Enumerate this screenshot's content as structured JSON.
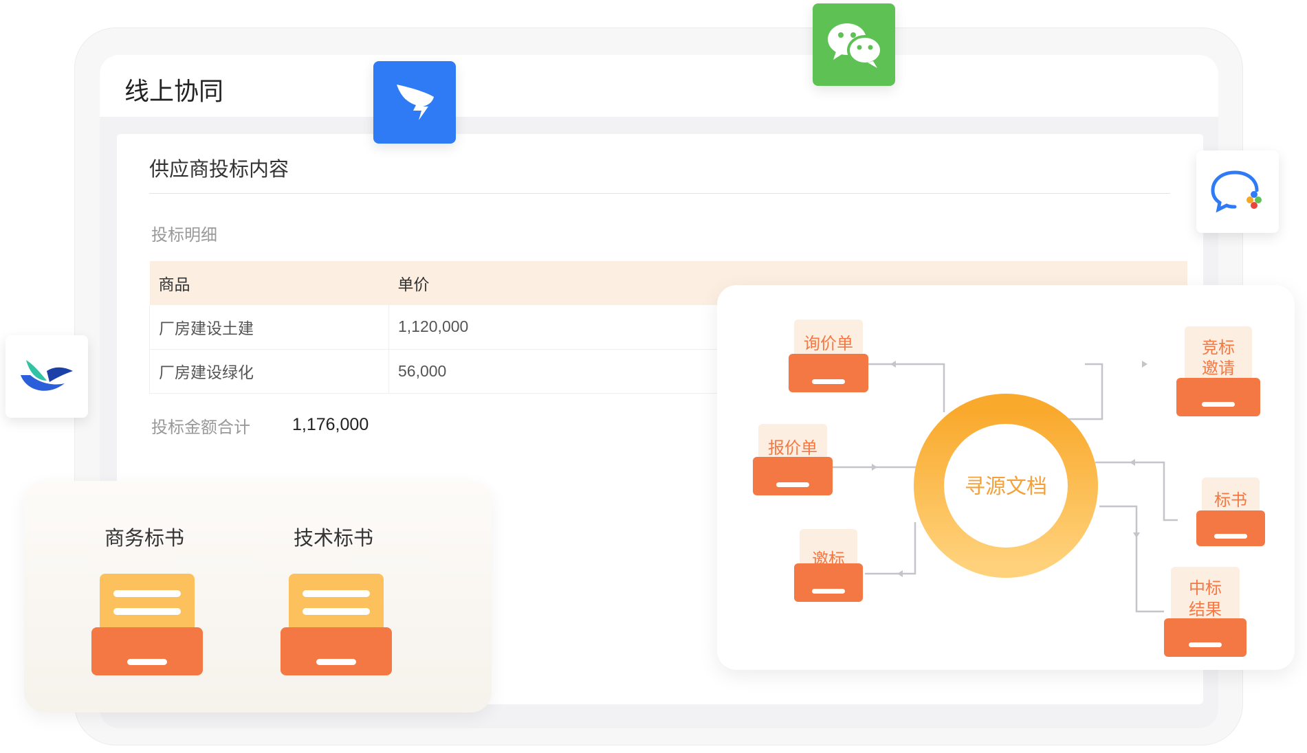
{
  "window": {
    "title": "线上协同"
  },
  "bid_section": {
    "title": "供应商投标内容",
    "subtitle": "投标明细",
    "columns": [
      "商品",
      "单价"
    ],
    "rows": [
      {
        "item": "厂房建设土建",
        "price": "1,120,000"
      },
      {
        "item": "厂房建设绿化",
        "price": "56,000"
      }
    ],
    "total_label": "投标金额合计",
    "total_value": "1,176,000"
  },
  "tender_docs": {
    "business": "商务标书",
    "technical": "技术标书"
  },
  "sourcing": {
    "center": "寻源文档",
    "inquiry": "询价单",
    "quotation": "报价单",
    "invitation": "邀标",
    "bid_invite_line1": "竞标",
    "bid_invite_line2": "邀请",
    "bid_doc": "标书",
    "award_line1": "中标",
    "award_line2": "结果"
  },
  "apps": {
    "dingtalk": "dingtalk-icon",
    "wechat": "wechat-icon",
    "wecom": "wecom-icon",
    "feishu": "feishu-icon"
  },
  "colors": {
    "orange": "#f47843",
    "folder_yellow": "#fcc15d",
    "ring_start": "#f9a92c",
    "ring_end": "#ffd17a",
    "dingtalk_blue": "#2f7bf6",
    "wechat_green": "#5ec154",
    "table_header": "#fdeee2"
  }
}
